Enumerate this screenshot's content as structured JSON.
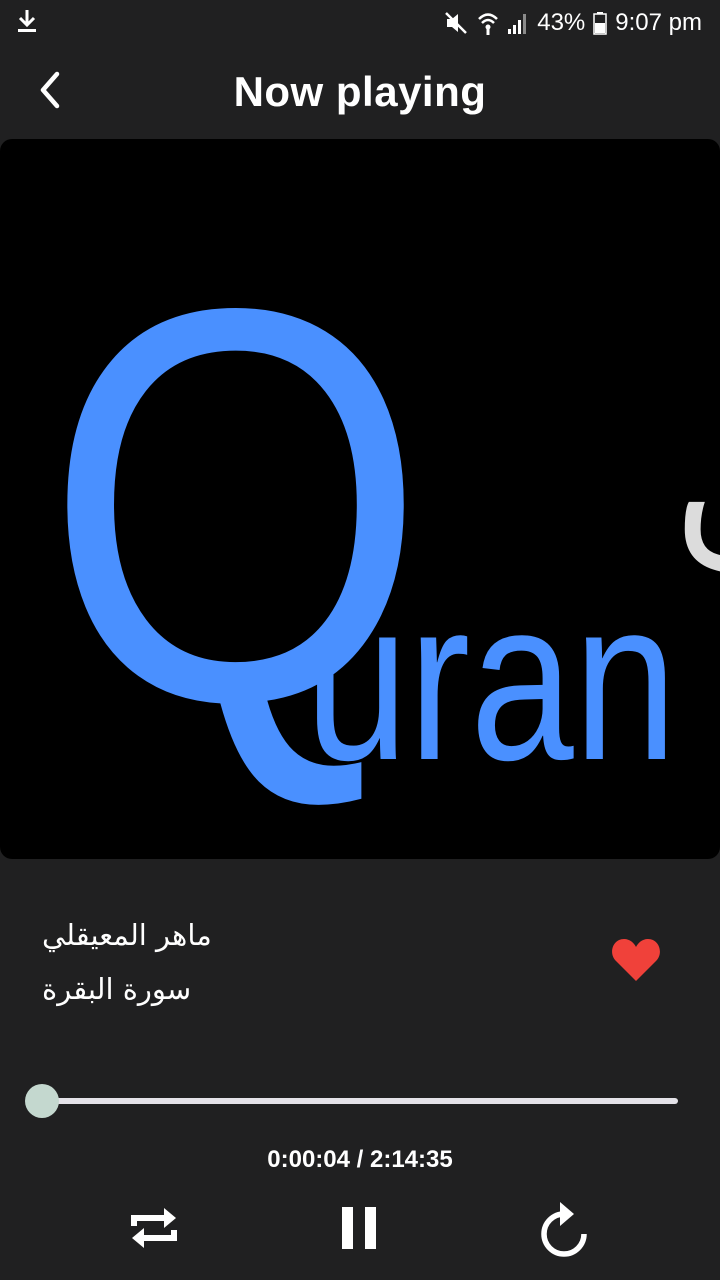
{
  "status_bar": {
    "battery_percent": "43%",
    "time": "9:07 pm",
    "icons": [
      "download-icon",
      "mute-icon",
      "wifi-icon",
      "signal-icon",
      "battery-icon"
    ]
  },
  "header": {
    "title": "Now playing",
    "back_icon": "chevron-left-icon"
  },
  "artwork": {
    "letter": "Q",
    "arabic_word": "قرآن",
    "latin_word": "uran",
    "colors": {
      "blue": "#4a90ff",
      "gray": "#dcdcdc",
      "background": "#000000"
    }
  },
  "track": {
    "artist": "ماهر المعيقلي",
    "surah": "سورة البقرة",
    "favorite": true
  },
  "player": {
    "progress_fraction": 0.0005,
    "time_display": "0:00:04 / 2:14:35",
    "controls": [
      "repeat-icon",
      "pause-icon",
      "replay-icon"
    ]
  },
  "colors": {
    "background": "#202021",
    "heart": "#f0413a",
    "seek_thumb": "#c4d8cf",
    "seek_track": "#e4e2e8"
  }
}
